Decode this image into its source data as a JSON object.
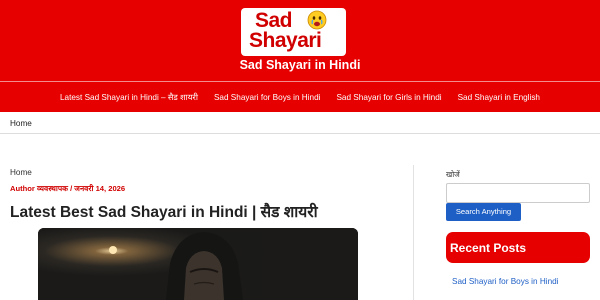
{
  "header": {
    "logo": {
      "line1": "Sad",
      "line2": "Shayari"
    },
    "tagline": "Sad Shayari in Hindi",
    "bg_color": "#e60000"
  },
  "nav": {
    "items": [
      {
        "label": "Latest Sad Shayari in Hindi – सैड शायरी"
      },
      {
        "label": "Sad Shayari for Boys in Hindi"
      },
      {
        "label": "Sad Shayari for Girls in Hindi"
      },
      {
        "label": "Sad Shayari in English"
      }
    ]
  },
  "breadcrumb_bar": {
    "label": "Home"
  },
  "article": {
    "breadcrumb": "Home",
    "meta": "Author व्यवस्थापक / जनवरी 14, 2026",
    "title": "Latest Best Sad Shayari in Hindi | सैड शायरी"
  },
  "sidebar": {
    "search_label": "खोजें",
    "search_value": "",
    "search_button": "Search Anything",
    "recent_title": "Recent Posts",
    "recent_items": [
      {
        "label": "Sad Shayari for Boys in Hindi"
      }
    ]
  },
  "colors": {
    "brand_red": "#e60000",
    "link_blue": "#1e5fc6",
    "button_blue": "#1e5fc6"
  },
  "icons": {
    "logo_emoji": "crying-face-icon"
  }
}
